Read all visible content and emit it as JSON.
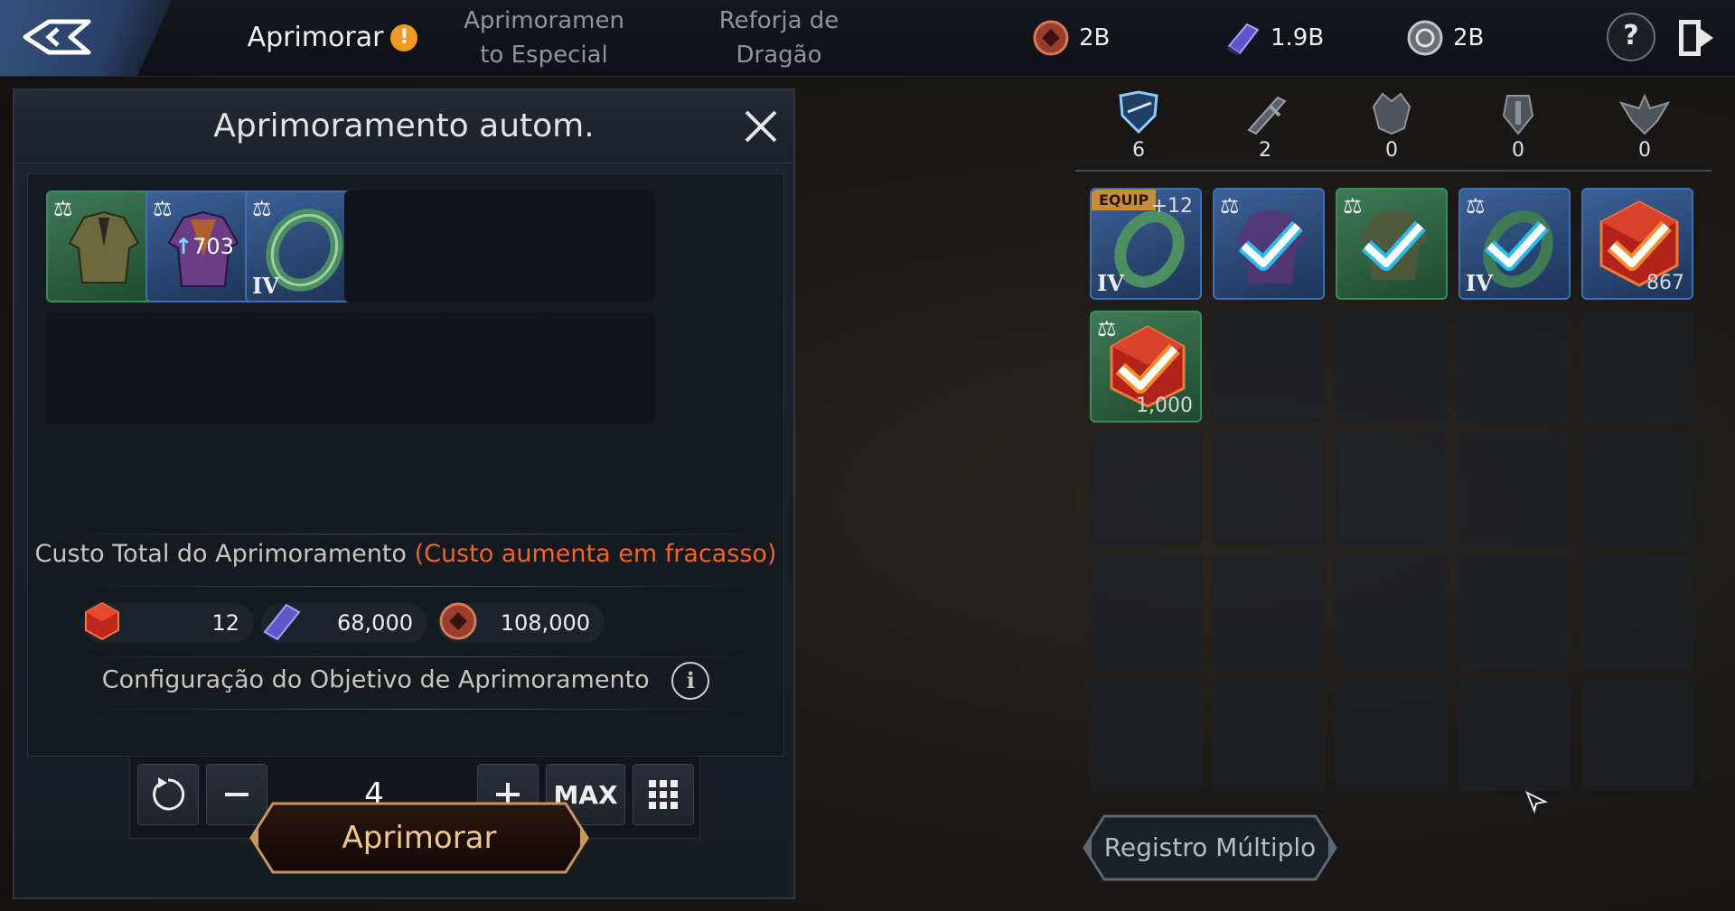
{
  "topbar": {
    "tabs": [
      {
        "label": "Aprimorar",
        "active": true
      },
      {
        "label_line1": "Aprimoramen",
        "label_line2": "to Especial"
      },
      {
        "label_line1": "Reforja de",
        "label_line2": "Dragão"
      }
    ],
    "alert_mark": "!",
    "currencies": [
      {
        "icon": "copper-coin-icon",
        "value": "2B"
      },
      {
        "icon": "purple-stone-icon",
        "value": "1.9B"
      },
      {
        "icon": "silver-coin-icon",
        "value": "2B"
      }
    ],
    "help_label": "?"
  },
  "panel": {
    "title": "Aprimoramento autom.",
    "selected_items": [
      {
        "icon": "green-robe-icon",
        "grade": "green",
        "locked": true
      },
      {
        "icon": "purple-robe-icon",
        "grade": "blue",
        "locked": true,
        "score": "703"
      },
      {
        "icon": "jade-ring-icon",
        "grade": "blue",
        "locked": true,
        "tier": "IV"
      }
    ],
    "cost_title": "Custo Total do Aprimoramento",
    "cost_warning": "(Custo aumenta em fracasso)",
    "costs": [
      {
        "icon": "red-cube-icon",
        "value": "12"
      },
      {
        "icon": "purple-stone-icon",
        "value": "68,000"
      },
      {
        "icon": "copper-coin-icon",
        "value": "108,000"
      }
    ],
    "goal_label": "Configuração do Objetivo de Aprimoramento",
    "goal_value": "4",
    "max_label": "MAX",
    "action_label": "Aprimorar"
  },
  "inventory": {
    "categories": [
      {
        "icon": "armor-shield-icon",
        "count": "6",
        "active": true
      },
      {
        "icon": "weapon-icon",
        "count": "2"
      },
      {
        "icon": "dragon-head-icon",
        "count": "0"
      },
      {
        "icon": "emblem-icon",
        "count": "0"
      },
      {
        "icon": "winged-crest-icon",
        "count": "0"
      }
    ],
    "items": [
      {
        "icon": "jade-ring-icon",
        "grade": "blue",
        "equip_label": "EQUIP",
        "plus": "+12",
        "tier": "IV"
      },
      {
        "icon": "purple-robe-icon",
        "grade": "blue",
        "locked": true,
        "checked": true
      },
      {
        "icon": "green-robe-icon",
        "grade": "green",
        "locked": true,
        "checked": true
      },
      {
        "icon": "jade-ring-icon",
        "grade": "blue",
        "locked": true,
        "checked": true,
        "tier": "IV"
      },
      {
        "icon": "red-cube-icon",
        "grade": "blue",
        "checked": true,
        "count": "867"
      },
      {
        "icon": "red-cube-icon",
        "grade": "green",
        "locked": true,
        "checked": true,
        "count": "1,000"
      }
    ],
    "multi_register_label": "Registro Múltiplo"
  }
}
